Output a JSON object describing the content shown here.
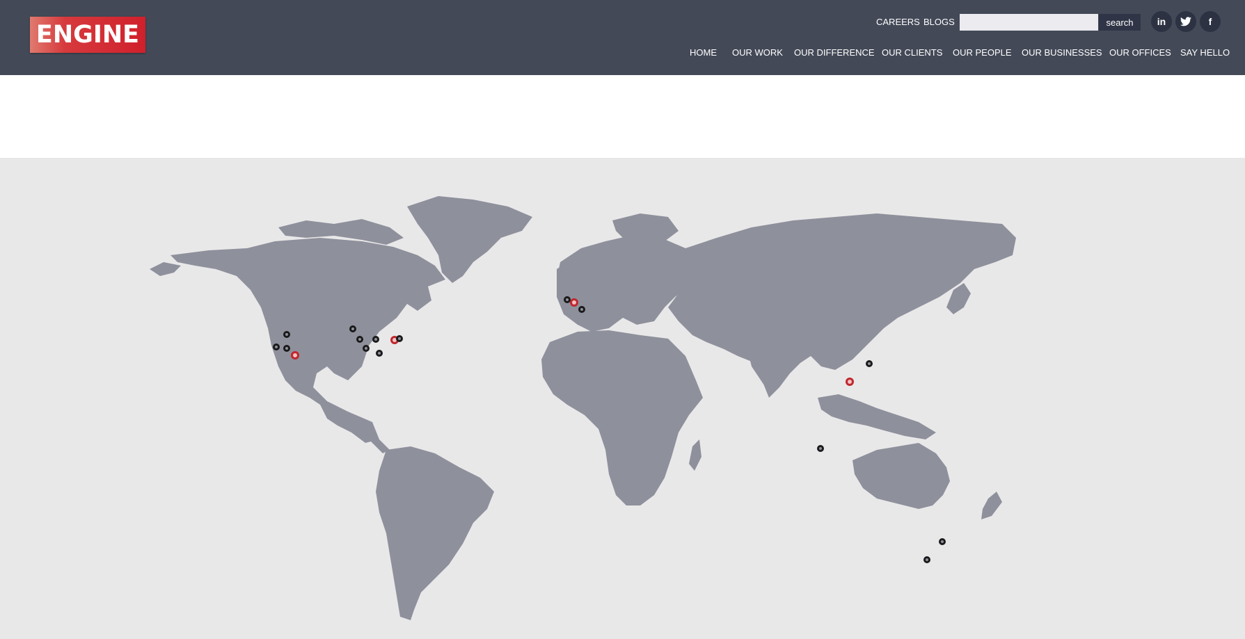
{
  "brand": {
    "logo_text": "ENGINE"
  },
  "header": {
    "top_links": [
      "CAREERS",
      "BLOGS"
    ],
    "search": {
      "placeholder": "",
      "button_label": "search"
    },
    "social": [
      "in",
      "t",
      "f"
    ],
    "nav": [
      "HOME",
      "OUR WORK",
      "OUR DIFFERENCE",
      "OUR CLIENTS",
      "OUR PEOPLE",
      "OUR BUSINESSES",
      "OUR OFFICES",
      "SAY HELLO"
    ]
  },
  "colors": {
    "header_bg": "#434957",
    "land": "#8e909c",
    "map_bg": "#e9e8e9",
    "pin_primary": "#c0272d",
    "pin_secondary": "#1a1a1a"
  },
  "map": {
    "region": "world",
    "pins": {
      "red": 4,
      "black": 16
    }
  }
}
